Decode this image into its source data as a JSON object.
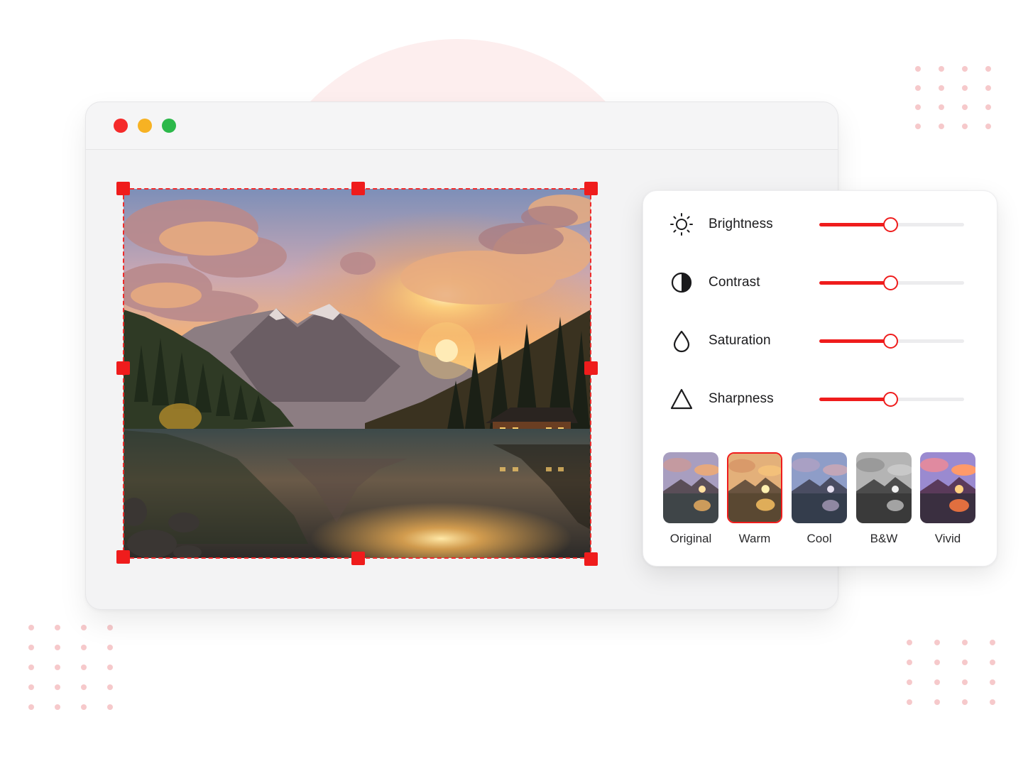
{
  "window": {
    "controls": [
      "close",
      "minimize",
      "maximize"
    ],
    "colors": {
      "close": "#f52a2a",
      "minimize": "#f7b223",
      "maximize": "#2cb84a"
    }
  },
  "canvas": {
    "image": "mountain-lake-sunset-photo",
    "crop_handles": [
      "top-left",
      "top-center",
      "top-right",
      "middle-left",
      "middle-right",
      "bottom-left",
      "bottom-center",
      "bottom-right"
    ]
  },
  "adjustments": [
    {
      "label": "Brightness",
      "icon": "sun-icon",
      "value": 0.49
    },
    {
      "label": "Contrast",
      "icon": "contrast-icon",
      "value": 0.49
    },
    {
      "label": "Saturation",
      "icon": "droplet-icon",
      "value": 0.49
    },
    {
      "label": "Sharpness",
      "icon": "triangle-icon",
      "value": 0.49
    }
  ],
  "filters": [
    {
      "label": "Original",
      "selected": false
    },
    {
      "label": "Warm",
      "selected": true
    },
    {
      "label": "Cool",
      "selected": false
    },
    {
      "label": "B&W",
      "selected": false
    },
    {
      "label": "Vivid",
      "selected": false
    }
  ],
  "accent_color": "#ef1c1c"
}
